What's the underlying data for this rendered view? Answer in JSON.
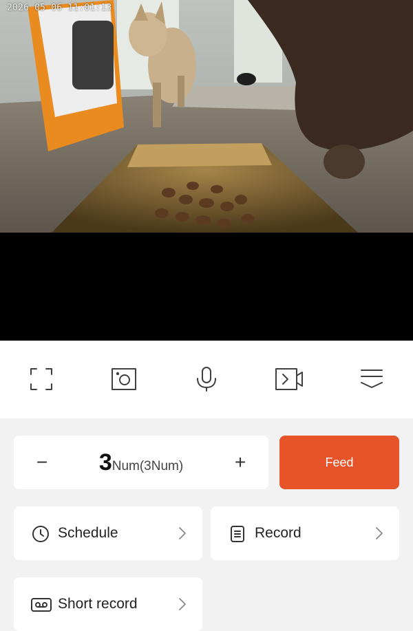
{
  "video": {
    "timestamp": "2026 05 06 11:01:13"
  },
  "controls": [
    {
      "name": "fullscreen-icon"
    },
    {
      "name": "snapshot-icon"
    },
    {
      "name": "microphone-icon"
    },
    {
      "name": "video-record-icon"
    },
    {
      "name": "more-menu-icon"
    }
  ],
  "quantity": {
    "minus": "−",
    "plus": "+",
    "value": "3",
    "unit": "Num(3Num)"
  },
  "feed_button": "Feed",
  "tiles": {
    "schedule": "Schedule",
    "record": "Record",
    "short_record": "Short record"
  },
  "colors": {
    "accent": "#e8542a",
    "background": "#f2f2f2"
  }
}
